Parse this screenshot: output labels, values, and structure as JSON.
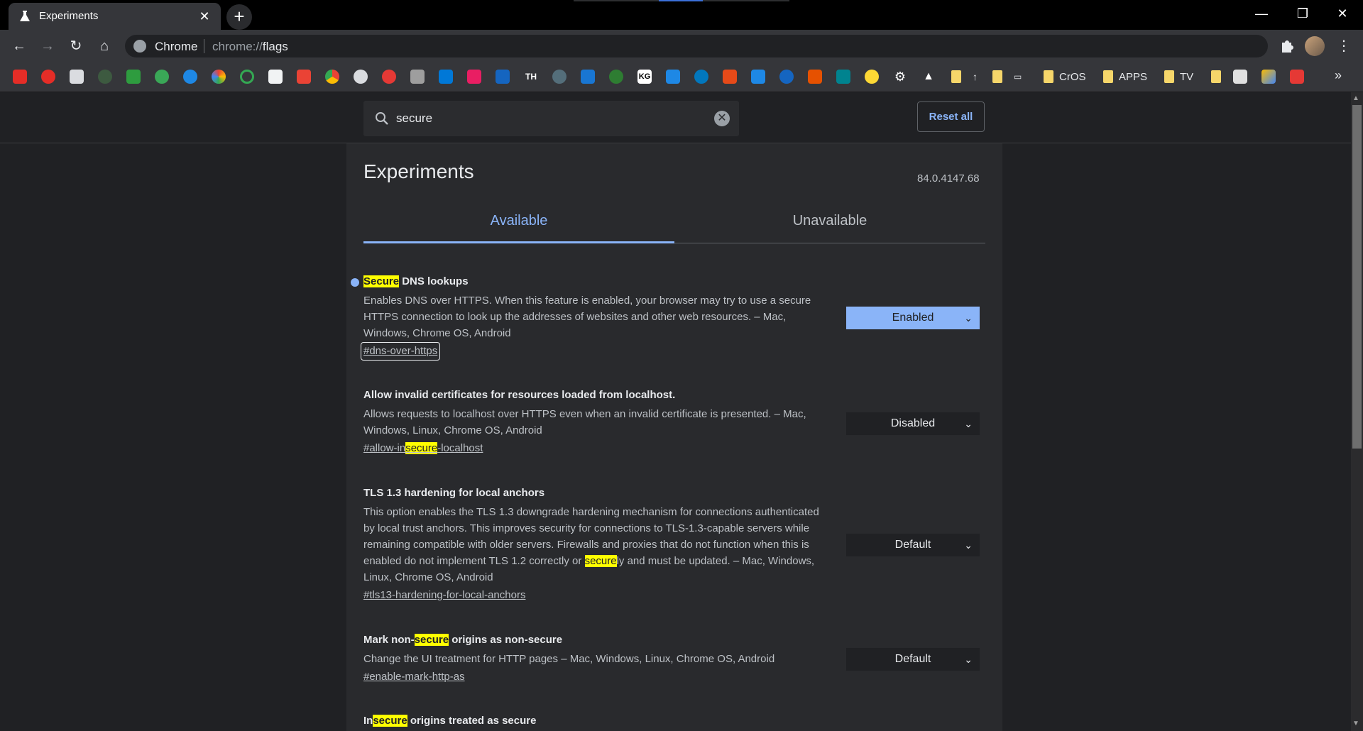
{
  "tab": {
    "title": "Experiments",
    "close": "✕",
    "new_tab": "+"
  },
  "window_controls": {
    "minimize": "—",
    "restore": "❐",
    "close": "✕"
  },
  "toolbar": {
    "back": "←",
    "forward": "→",
    "reload": "↻",
    "home": "⌂",
    "omnibox_site": "Chrome",
    "omnibox_scheme": "chrome://",
    "omnibox_path": "flags"
  },
  "bookmarks": {
    "folders": [
      {
        "label": ""
      },
      {
        "label": ""
      },
      {
        "label": "CrOS"
      },
      {
        "label": "APPS"
      },
      {
        "label": "TV"
      },
      {
        "label": ""
      }
    ],
    "text_marks": [
      "TH",
      "KG"
    ],
    "more": "»"
  },
  "search": {
    "value": "secure",
    "clear": "✕"
  },
  "reset_button": "Reset all",
  "page": {
    "title": "Experiments",
    "version": "84.0.4147.68",
    "tabs": {
      "available": "Available",
      "unavailable": "Unavailable"
    }
  },
  "experiments": [
    {
      "name_hl": "Secure",
      "name_rest": " DNS lookups",
      "description": "Enables DNS over HTTPS. When this feature is enabled, your browser may try to use a secure HTTPS connection to look up the addresses of websites and other web resources. – Mac, Windows, Chrome OS, Android",
      "link": "#dns-over-https",
      "value": "Enabled"
    },
    {
      "name": "Allow invalid certificates for resources loaded from localhost.",
      "description": "Allows requests to localhost over HTTPS even when an invalid certificate is presented. – Mac, Windows, Linux, Chrome OS, Android",
      "link_pre": "#allow-in",
      "link_hl": "secure",
      "link_post": "-localhost",
      "value": "Disabled"
    },
    {
      "name": "TLS 1.3 hardening for local anchors",
      "description_pre": "This option enables the TLS 1.3 downgrade hardening mechanism for connections authenticated by local trust anchors. This improves security for connections to TLS-1.3-capable servers while remaining compatible with older servers. Firewalls and proxies that do not function when this is enabled do not implement TLS 1.2 correctly or ",
      "description_hl": "secure",
      "description_post": "ly and must be updated. – Mac, Windows, Linux, Chrome OS, Android",
      "link": "#tls13-hardening-for-local-anchors",
      "value": "Default"
    },
    {
      "name_pre": "Mark non-",
      "name_hl": "secure",
      "name_post": " origins as non-secure",
      "description": "Change the UI treatment for HTTP pages – Mac, Windows, Linux, Chrome OS, Android",
      "link": "#enable-mark-http-as",
      "value": "Default"
    },
    {
      "name_pre": "In",
      "name_hl": "secure",
      "name_post": " origins treated as secure"
    }
  ],
  "colors": {
    "accent": "#8ab4f8",
    "highlight": "#ffff00",
    "panel": "#292a2d",
    "background": "#202124"
  }
}
